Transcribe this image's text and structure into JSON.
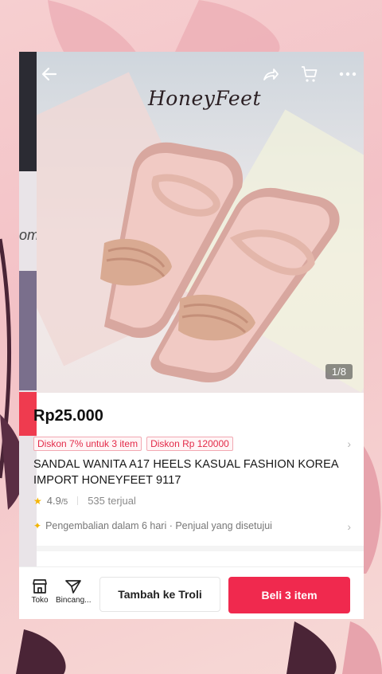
{
  "header": {
    "back_icon": "arrow-left-icon",
    "share_icon": "share-icon",
    "cart_icon": "cart-icon",
    "more_icon": "more-icon"
  },
  "gallery": {
    "brand_text": "HoneyFeet",
    "counter": "1/8"
  },
  "side_preview": {
    "text": "om"
  },
  "product": {
    "price": "Rp25.000",
    "tags": [
      "Diskon 7% untuk 3 item",
      "Diskon Rp 120000"
    ],
    "title_line1": "SANDAL WANITA A17 HEELS KASUAL FASHION KOREA",
    "title_line2": "IMPORT HONEYFEET 9117",
    "rating": "4.9",
    "rating_max": "/5",
    "sold": "535 terjual",
    "policy": "Pengembalian dalam 6 hari · Penjual yang disetujui"
  },
  "bottom_bar": {
    "shop_label": "Toko",
    "chat_label": "Bincang...",
    "add_to_cart": "Tambah ke Troli",
    "buy": "Beli 3 item"
  },
  "colors": {
    "accent": "#f0294e",
    "tag_text": "#e32b49",
    "background": "#f3c1c6"
  }
}
